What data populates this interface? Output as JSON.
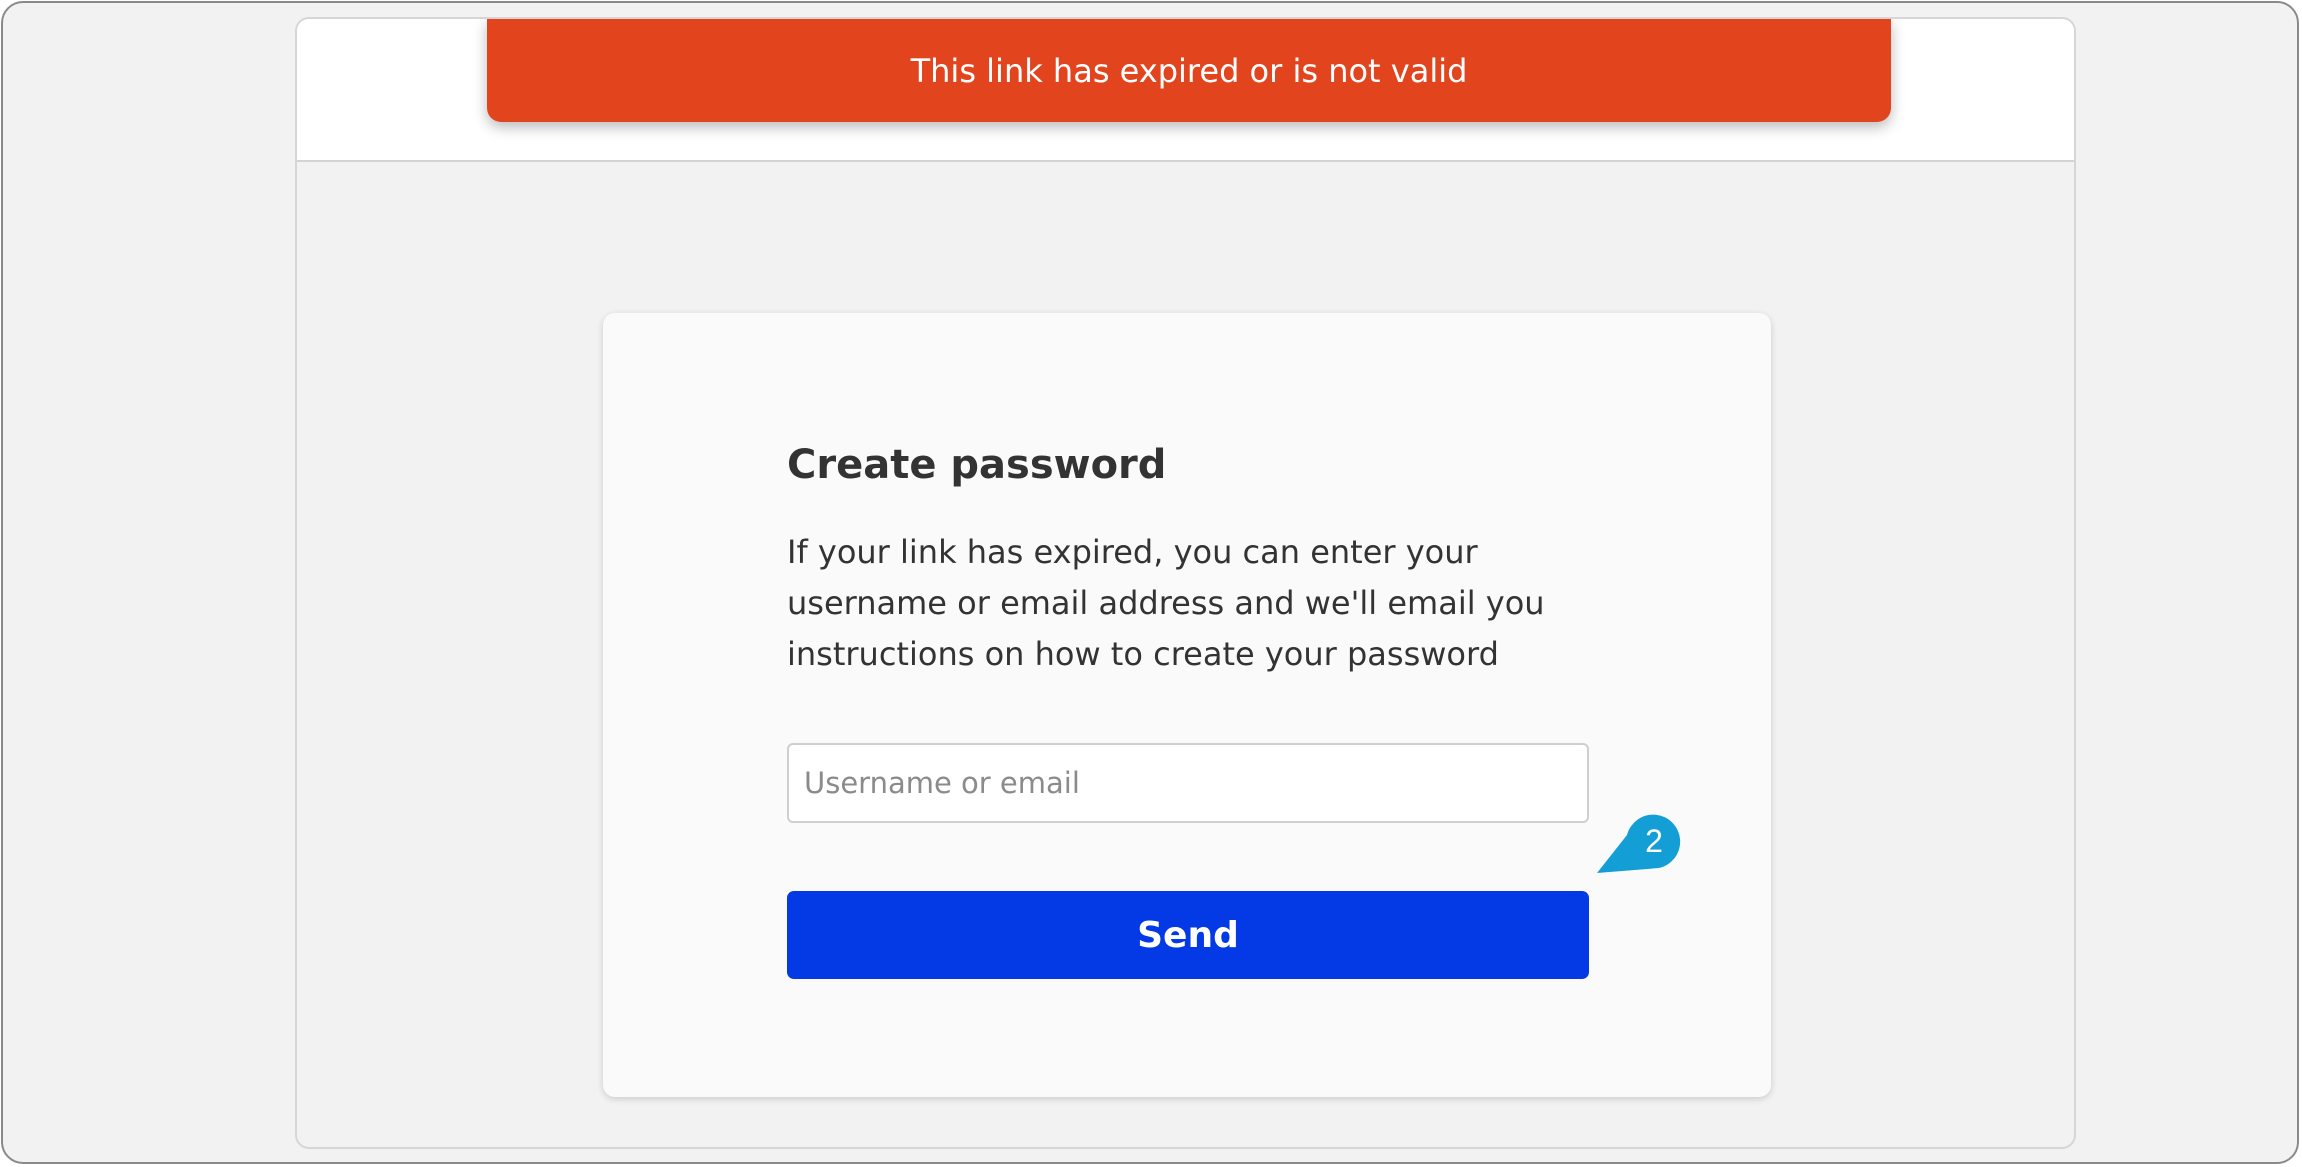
{
  "alert": {
    "message": "This link has expired or is not valid",
    "color": "#e2451e"
  },
  "form": {
    "title": "Create password",
    "description": "If your link has expired, you can enter your username or email address and we'll email you instructions on how to create your password",
    "input": {
      "placeholder": "Username or email",
      "value": ""
    },
    "submit_label": "Send",
    "submit_color": "#033ae6"
  },
  "annotation": {
    "step": "2",
    "color": "#139fd6"
  }
}
